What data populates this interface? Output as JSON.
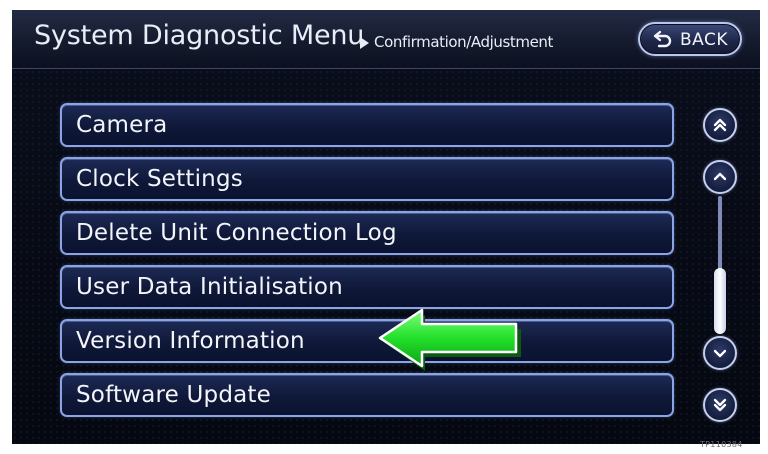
{
  "header": {
    "title": "System Diagnostic Menu",
    "breadcrumb": "Confirmation/Adjustment",
    "back_label": "BACK"
  },
  "menu": {
    "items": [
      {
        "label": "Camera"
      },
      {
        "label": "Clock Settings"
      },
      {
        "label": "Delete Unit Connection Log"
      },
      {
        "label": "User Data Initialisation"
      },
      {
        "label": "Version Information",
        "highlighted": true
      },
      {
        "label": "Software Update"
      }
    ]
  },
  "scrollbar": {
    "position_fraction": 0.85
  },
  "annotation": {
    "arrow_color": "#22e02a",
    "points_to": "Version Information"
  },
  "footer": {
    "reference_code": "TP110384"
  },
  "colors": {
    "screen_bg": "#050810",
    "button_border": "#8aa4e6",
    "text": "#f3f5fb"
  }
}
